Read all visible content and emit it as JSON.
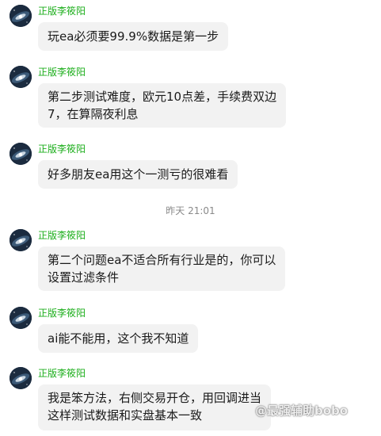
{
  "messages": [
    {
      "sender": "正版李筱阳",
      "lines": [
        "玩ea必须要99.9%数据是第一步"
      ]
    },
    {
      "sender": "正版李筱阳",
      "lines": [
        "第二步测试难度，欧元10点差，手续费双边",
        "7，在算隔夜利息"
      ]
    },
    {
      "sender": "正版李筱阳",
      "lines": [
        "好多朋友ea用这个一测亏的很难看"
      ]
    },
    {
      "sender": "正版李筱阳",
      "lines": [
        "第二个问题ea不适合所有行业是的，你可以",
        "设置过滤条件"
      ]
    },
    {
      "sender": "正版李筱阳",
      "lines": [
        "ai能不能用，这个我不知道"
      ]
    },
    {
      "sender": "正版李筱阳",
      "lines": [
        "我是笨方法，右侧交易开仓，用回调进当",
        "这样测试数据和实盘基本一致"
      ]
    }
  ],
  "timestamp": "昨天 21:01",
  "watermark": "@最强辅助bobo",
  "colors": {
    "sender_name": "#1aad19",
    "bubble_bg": "#f2f2f2",
    "timestamp": "#8a8a8a"
  }
}
